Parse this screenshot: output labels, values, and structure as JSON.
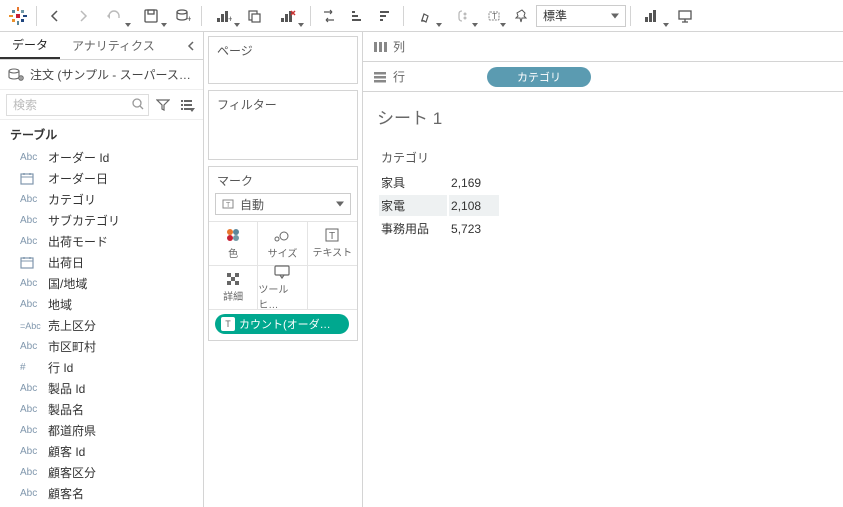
{
  "toolbar": {
    "fit_label": "標準"
  },
  "left": {
    "tab_data": "データ",
    "tab_analytics": "アナリティクス",
    "datasource": "注文 (サンプル - スーパース…",
    "search_placeholder": "検索",
    "tables_label": "テーブル",
    "fields": [
      {
        "type": "Abc",
        "name": "オーダー Id"
      },
      {
        "type": "date",
        "name": "オーダー日"
      },
      {
        "type": "Abc",
        "name": "カテゴリ"
      },
      {
        "type": "Abc",
        "name": "サブカテゴリ"
      },
      {
        "type": "Abc",
        "name": "出荷モード"
      },
      {
        "type": "date",
        "name": "出荷日"
      },
      {
        "type": "Abc",
        "name": "国/地域"
      },
      {
        "type": "Abc",
        "name": "地域"
      },
      {
        "type": "eAbc",
        "name": "売上区分"
      },
      {
        "type": "Abc",
        "name": "市区町村"
      },
      {
        "type": "#",
        "name": "行 Id"
      },
      {
        "type": "Abc",
        "name": "製品 Id"
      },
      {
        "type": "Abc",
        "name": "製品名"
      },
      {
        "type": "Abc",
        "name": "都道府県"
      },
      {
        "type": "Abc",
        "name": "顧客 Id"
      },
      {
        "type": "Abc",
        "name": "顧客区分"
      },
      {
        "type": "Abc",
        "name": "顧客名"
      }
    ]
  },
  "cards": {
    "pages": "ページ",
    "filters": "フィルター",
    "marks": "マーク",
    "mark_type": "自動",
    "cells": {
      "color": "色",
      "size": "サイズ",
      "text": "テキスト",
      "detail": "詳細",
      "tooltip": "ツールヒ…"
    },
    "mark_pill": "カウント(オーダー .."
  },
  "shelves": {
    "columns": "列",
    "rows": "行",
    "row_pill": "カテゴリ"
  },
  "viz": {
    "title": "シート 1",
    "header": "カテゴリ",
    "rows": [
      {
        "label": "家具",
        "value": "2,169",
        "hl": false
      },
      {
        "label": "家電",
        "value": "2,108",
        "hl": true
      },
      {
        "label": "事務用品",
        "value": "5,723",
        "hl": false
      }
    ]
  },
  "chart_data": {
    "type": "table",
    "title": "シート 1",
    "categories": [
      "家具",
      "家電",
      "事務用品"
    ],
    "values": [
      2169,
      2108,
      5723
    ],
    "column_header": "カテゴリ",
    "measure": "カウント(オーダー)"
  }
}
